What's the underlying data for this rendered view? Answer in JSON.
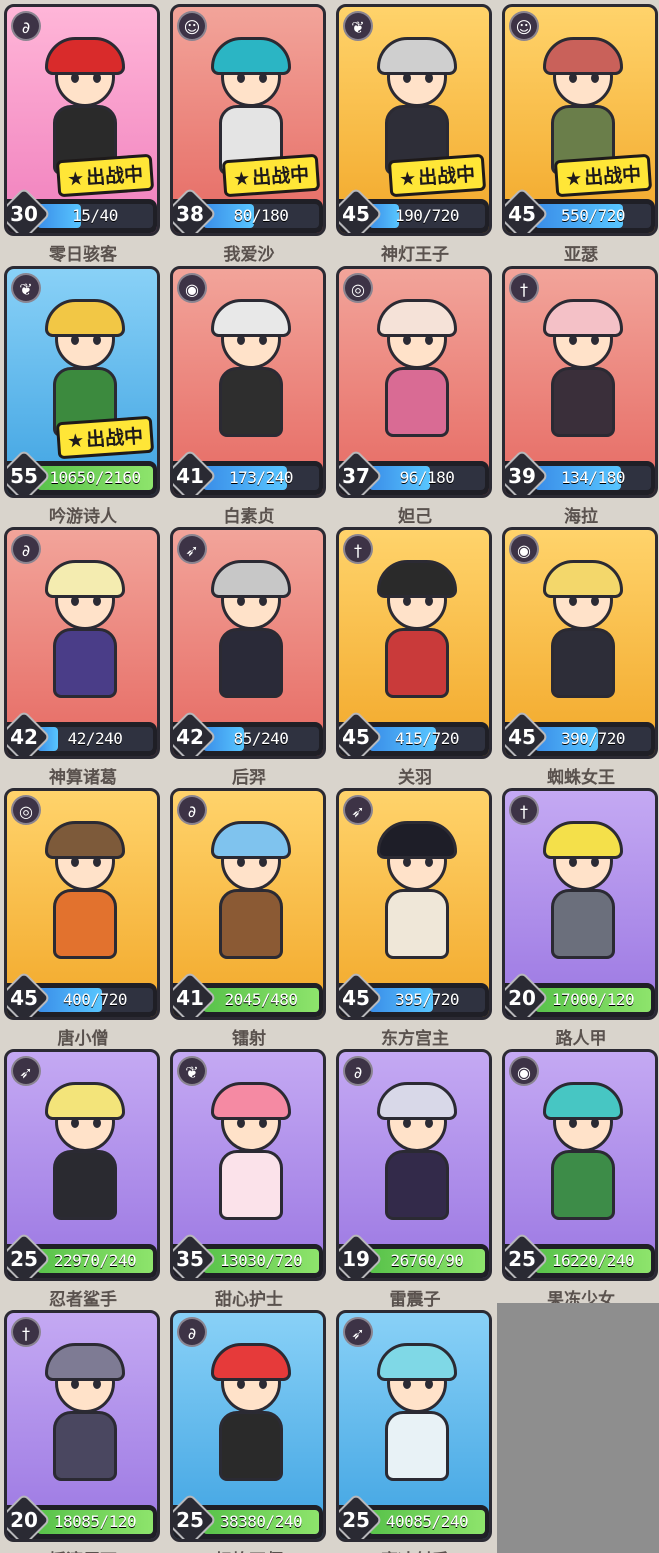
{
  "deploy_label": "出战中",
  "colors": {
    "red": "#e66a63",
    "pink": "#f07fbd",
    "gold": "#f2a82a",
    "blue": "#3fa3e2",
    "purple": "#9b77e2",
    "progress_blue": "#3a8de8",
    "progress_green": "#58c24a"
  },
  "heroes": [
    {
      "name": "零日骇客",
      "level": "30",
      "fragments": "15/40",
      "progress": 0.375,
      "bar": "blue",
      "bg": "pink",
      "icon": "magic-icon",
      "deployed": true,
      "hair": "#d92b2b",
      "body": "#2a2a2a"
    },
    {
      "name": "我爱沙",
      "level": "38",
      "fragments": "80/180",
      "progress": 0.44,
      "bar": "blue",
      "bg": "red",
      "icon": "ghost-icon",
      "deployed": true,
      "hair": "#2bb5c4",
      "body": "#e4e4e4"
    },
    {
      "name": "神灯王子",
      "level": "45",
      "fragments": "190/720",
      "progress": 0.26,
      "bar": "blue",
      "bg": "gold",
      "icon": "wings-icon",
      "deployed": true,
      "hair": "#cfcfcf",
      "body": "#2e2e38"
    },
    {
      "name": "亚瑟",
      "level": "45",
      "fragments": "550/720",
      "progress": 0.76,
      "bar": "blue",
      "bg": "gold",
      "icon": "ghost-icon",
      "deployed": true,
      "hair": "#c9615a",
      "body": "#6a7e4a"
    },
    {
      "name": "吟游诗人",
      "level": "55",
      "fragments": "10650/2160",
      "progress": 1,
      "bar": "green",
      "bg": "blue",
      "icon": "wings-icon",
      "deployed": true,
      "hair": "#f2c745",
      "body": "#3c8a3e"
    },
    {
      "name": "白素贞",
      "level": "41",
      "fragments": "173/240",
      "progress": 0.72,
      "bar": "blue",
      "bg": "red",
      "icon": "cat-icon",
      "deployed": false,
      "hair": "#e8e8e8",
      "body": "#2e2e2e"
    },
    {
      "name": "妲己",
      "level": "37",
      "fragments": "96/180",
      "progress": 0.53,
      "bar": "blue",
      "bg": "red",
      "icon": "swirl-icon",
      "deployed": false,
      "hair": "#f5e2d8",
      "body": "#d96b94"
    },
    {
      "name": "海拉",
      "level": "39",
      "fragments": "134/180",
      "progress": 0.74,
      "bar": "blue",
      "bg": "red",
      "icon": "sword-icon",
      "deployed": false,
      "hair": "#f4c1c7",
      "body": "#3a2f3a"
    },
    {
      "name": "神算诸葛",
      "level": "42",
      "fragments": "42/240",
      "progress": 0.18,
      "bar": "blue",
      "bg": "red",
      "icon": "magic-icon",
      "deployed": false,
      "hair": "#f4ecb0",
      "body": "#4a3d88"
    },
    {
      "name": "后羿",
      "level": "42",
      "fragments": "85/240",
      "progress": 0.35,
      "bar": "blue",
      "bg": "red",
      "icon": "bow-icon",
      "deployed": false,
      "hair": "#c7c7c7",
      "body": "#2a2a38"
    },
    {
      "name": "关羽",
      "level": "45",
      "fragments": "415/720",
      "progress": 0.58,
      "bar": "blue",
      "bg": "gold",
      "icon": "sword-icon",
      "deployed": false,
      "hair": "#2a2a2a",
      "body": "#c93a3a"
    },
    {
      "name": "蜘蛛女王",
      "level": "45",
      "fragments": "390/720",
      "progress": 0.54,
      "bar": "blue",
      "bg": "gold",
      "icon": "cat-icon",
      "deployed": false,
      "hair": "#f3d76b",
      "body": "#2d2d38"
    },
    {
      "name": "唐小僧",
      "level": "45",
      "fragments": "400/720",
      "progress": 0.56,
      "bar": "blue",
      "bg": "gold",
      "icon": "swirl-icon",
      "deployed": false,
      "hair": "#7d5a3a",
      "body": "#e2722e"
    },
    {
      "name": "镭射",
      "level": "41",
      "fragments": "2045/480",
      "progress": 1,
      "bar": "green",
      "bg": "gold",
      "icon": "magic-icon",
      "deployed": false,
      "hair": "#7fc3ee",
      "body": "#8b5a34"
    },
    {
      "name": "东方宫主",
      "level": "45",
      "fragments": "395/720",
      "progress": 0.55,
      "bar": "blue",
      "bg": "gold",
      "icon": "bow-icon",
      "deployed": false,
      "hair": "#1e1e28",
      "body": "#efe7d8"
    },
    {
      "name": "路人甲",
      "level": "20",
      "fragments": "17000/120",
      "progress": 1,
      "bar": "green",
      "bg": "purple",
      "icon": "sword-icon",
      "deployed": false,
      "hair": "#f4e04a",
      "body": "#6b6f7c"
    },
    {
      "name": "忍者鲨手",
      "level": "25",
      "fragments": "22970/240",
      "progress": 1,
      "bar": "green",
      "bg": "purple",
      "icon": "bow-icon",
      "deployed": false,
      "hair": "#f3e47a",
      "body": "#2a2a30"
    },
    {
      "name": "甜心护士",
      "level": "35",
      "fragments": "13030/720",
      "progress": 1,
      "bar": "green",
      "bg": "purple",
      "icon": "wings-icon",
      "deployed": false,
      "hair": "#f58aa3",
      "body": "#fbe2ea"
    },
    {
      "name": "雷震子",
      "level": "19",
      "fragments": "26760/90",
      "progress": 1,
      "bar": "green",
      "bg": "purple",
      "icon": "magic-icon",
      "deployed": false,
      "hair": "#d8d8e8",
      "body": "#332a4a"
    },
    {
      "name": "果冻少女",
      "level": "25",
      "fragments": "16220/240",
      "progress": 1,
      "bar": "green",
      "bg": "purple",
      "icon": "cat-icon",
      "deployed": false,
      "hair": "#47c6c3",
      "body": "#3d8c48"
    },
    {
      "name": "摇滚巨石",
      "level": "20",
      "fragments": "18085/120",
      "progress": 1,
      "bar": "green",
      "bg": "purple",
      "icon": "sword-icon",
      "deployed": false,
      "hair": "#7e7b94",
      "body": "#4a4760"
    },
    {
      "name": "炽焰巫师",
      "level": "25",
      "fragments": "38380/240",
      "progress": 1,
      "bar": "green",
      "bg": "blue",
      "icon": "magic-icon",
      "deployed": false,
      "hair": "#e63a3a",
      "body": "#2a2a2a"
    },
    {
      "name": "寒冰射手",
      "level": "25",
      "fragments": "40085/240",
      "progress": 1,
      "bar": "green",
      "bg": "blue",
      "icon": "bow-icon",
      "deployed": false,
      "hair": "#7fd8e6",
      "body": "#e8f2f6"
    }
  ]
}
